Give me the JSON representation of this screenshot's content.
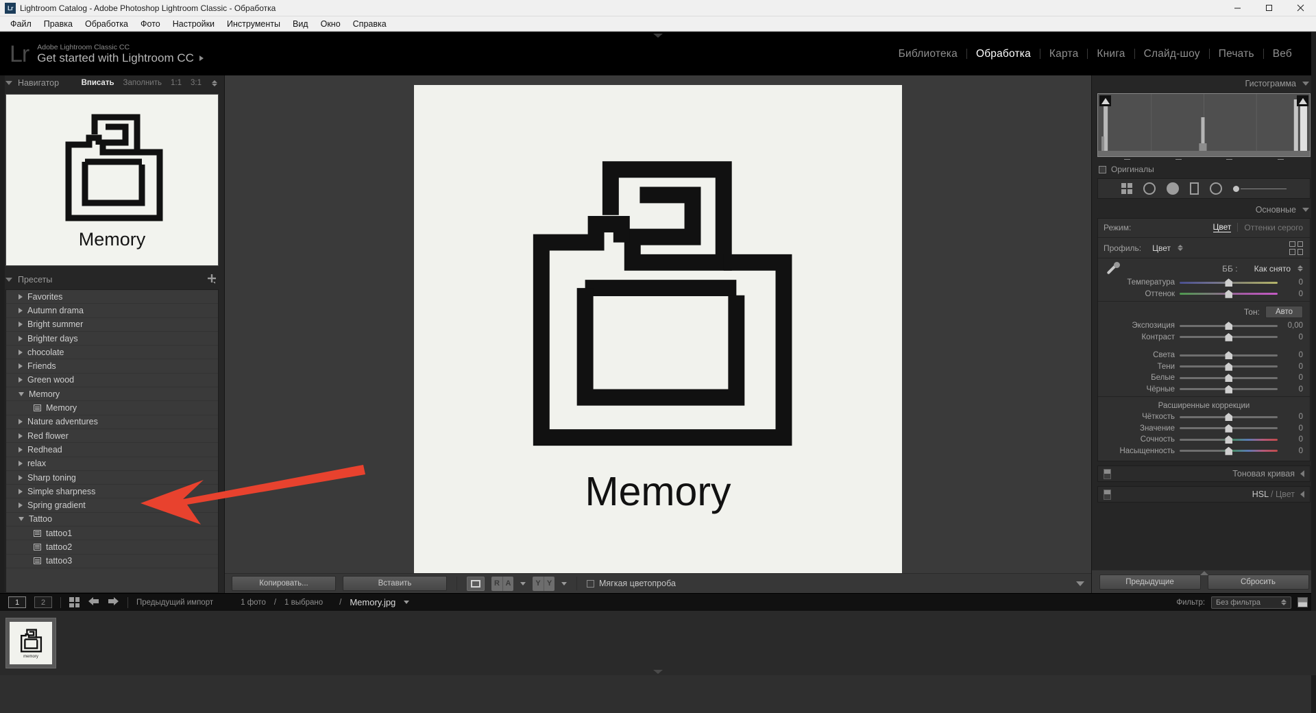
{
  "window": {
    "title": "Lightroom Catalog - Adobe Photoshop Lightroom Classic - Обработка",
    "app_icon": "Lr",
    "minimize": "—",
    "maximize": "▢",
    "close": "✕"
  },
  "menubar": {
    "items": [
      {
        "label": "Файл"
      },
      {
        "label": "Правка"
      },
      {
        "label": "Обработка"
      },
      {
        "label": "Фото"
      },
      {
        "label": "Настройки"
      },
      {
        "label": "Инструменты"
      },
      {
        "label": "Вид"
      },
      {
        "label": "Окно"
      },
      {
        "label": "Справка"
      }
    ]
  },
  "identity": {
    "logo": "Lr",
    "small": "Adobe Lightroom Classic CC",
    "big": "Get started with Lightroom CC"
  },
  "modules": [
    {
      "label": "Библиотека",
      "active": false
    },
    {
      "label": "Обработка",
      "active": true
    },
    {
      "label": "Карта",
      "active": false
    },
    {
      "label": "Книга",
      "active": false
    },
    {
      "label": "Слайд-шоу",
      "active": false
    },
    {
      "label": "Печать",
      "active": false
    },
    {
      "label": "Веб",
      "active": false
    }
  ],
  "navigator": {
    "title": "Навигатор",
    "modes": [
      {
        "label": "Вписать",
        "active": true
      },
      {
        "label": "Заполнить",
        "active": false
      },
      {
        "label": "1:1",
        "active": false
      },
      {
        "label": "3:1",
        "active": false
      }
    ],
    "thumbnail_label": "Memory"
  },
  "presets": {
    "title": "Пресеты",
    "add_icon": "plus-icon",
    "items": [
      {
        "label": "Favorites",
        "type": "group",
        "expanded": false
      },
      {
        "label": "Autumn drama",
        "type": "group",
        "expanded": false
      },
      {
        "label": "Bright summer",
        "type": "group",
        "expanded": false
      },
      {
        "label": "Brighter days",
        "type": "group",
        "expanded": false
      },
      {
        "label": "chocolate",
        "type": "group",
        "expanded": false
      },
      {
        "label": "Friends",
        "type": "group",
        "expanded": false
      },
      {
        "label": "Green wood",
        "type": "group",
        "expanded": false
      },
      {
        "label": "Memory",
        "type": "group",
        "expanded": true
      },
      {
        "label": "Memory",
        "type": "preset"
      },
      {
        "label": "Nature adventures",
        "type": "group",
        "expanded": false
      },
      {
        "label": "Red flower",
        "type": "group",
        "expanded": false
      },
      {
        "label": "Redhead",
        "type": "group",
        "expanded": false
      },
      {
        "label": "relax",
        "type": "group",
        "expanded": false
      },
      {
        "label": "Sharp toning",
        "type": "group",
        "expanded": false
      },
      {
        "label": "Simple sharpness",
        "type": "group",
        "expanded": false
      },
      {
        "label": "Spring gradient",
        "type": "group",
        "expanded": false
      },
      {
        "label": "Tattoo",
        "type": "group",
        "expanded": true
      },
      {
        "label": "tattoo1",
        "type": "preset"
      },
      {
        "label": "tattoo2",
        "type": "preset"
      },
      {
        "label": "tattoo3",
        "type": "preset"
      }
    ]
  },
  "photo": {
    "label": "Memory",
    "background_color": "#f1f2ed"
  },
  "annotation": {
    "type": "arrow",
    "color": "#e8422e",
    "points_to": "preset-memory"
  },
  "toolbar": {
    "copy_label": "Копировать...",
    "paste_label": "Вставить",
    "view_icon": "single-view-icon",
    "before_after_letters": [
      "R",
      "A"
    ],
    "yy_letters": [
      "Y",
      "Y"
    ],
    "soft_proof_label": "Мягкая цветопроба",
    "soft_proof_checked": false
  },
  "histogram": {
    "title": "Гистограмма",
    "originals_label": "Оригиналы",
    "originals_checked": false,
    "clip_left_icon": "shadow-clip-icon",
    "clip_right_icon": "highlight-clip-icon"
  },
  "tool_strip": {
    "icons": [
      "crop-icon",
      "spot-removal-icon",
      "red-eye-icon",
      "graduated-filter-icon",
      "radial-filter-icon",
      "adjustment-brush-slider"
    ]
  },
  "basic": {
    "title": "Основные",
    "treatment_label": "Режим:",
    "treatment_options": [
      {
        "label": "Цвет",
        "active": true
      },
      {
        "label": "Оттенки серого",
        "active": false
      }
    ],
    "profile_label": "Профиль:",
    "profile_value": "Цвет",
    "profile_grid_icon": "profile-browser-icon",
    "wb_eyedropper": "white-balance-eyedropper-icon",
    "wb_label": "ББ :",
    "wb_value": "Как снято",
    "wb_sliders": [
      {
        "name": "Температура",
        "value": "0",
        "track": "temp"
      },
      {
        "name": "Оттенок",
        "value": "0",
        "track": "tint"
      }
    ],
    "tone_label": "Тон:",
    "auto_label": "Авто",
    "tone_sliders": [
      {
        "name": "Экспозиция",
        "value": "0,00",
        "track": "plain"
      },
      {
        "name": "Контраст",
        "value": "0",
        "track": "plain"
      }
    ],
    "tone_sliders2": [
      {
        "name": "Света",
        "value": "0",
        "track": "plain"
      },
      {
        "name": "Тени",
        "value": "0",
        "track": "plain"
      },
      {
        "name": "Белые",
        "value": "0",
        "track": "plain"
      },
      {
        "name": "Чёрные",
        "value": "0",
        "track": "plain"
      }
    ],
    "presence_label": "Расширенные коррекции",
    "presence_sliders": [
      {
        "name": "Чёткость",
        "value": "0",
        "track": "plain"
      },
      {
        "name": "Значение",
        "value": "0",
        "track": "plain"
      },
      {
        "name": "Сочность",
        "value": "0",
        "track": "vib"
      },
      {
        "name": "Насыщенность",
        "value": "0",
        "track": "vib"
      }
    ]
  },
  "collapsed_panels": [
    {
      "title": "Тоновая кривая",
      "dim_suffix": ""
    },
    {
      "title": "HSL ",
      "dim_suffix": "/ Цвет"
    }
  ],
  "right_bottom": {
    "previous_label": "Предыдущие",
    "reset_label": "Сбросить"
  },
  "filmstrip": {
    "screen1": "1",
    "screen2": "2",
    "grid_icon": "grid-view-icon",
    "back_icon": "back-arrow-icon",
    "forward_icon": "forward-arrow-icon",
    "source": "Предыдущий импорт",
    "count": "1 фото",
    "sep1": "/",
    "selected": "1 выбрано",
    "sep2": "/",
    "filename": "Memory.jpg",
    "filter_label": "Фильтр:",
    "filter_value": "Без фильтра",
    "thumb_label": "memory"
  }
}
